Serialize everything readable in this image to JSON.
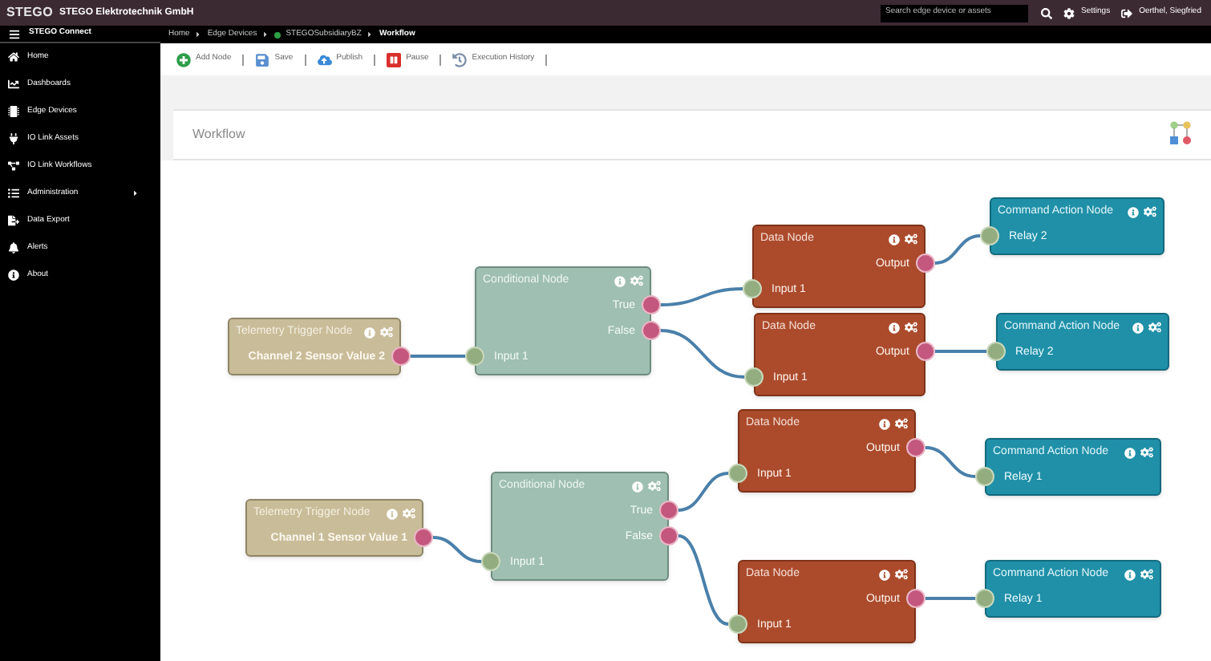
{
  "top_bar": {
    "logo": "STEGO",
    "company": "STEGO Elektrotechnik GmbH",
    "search": {
      "placeholder": "Search edge device or assets"
    },
    "settings": "Settings",
    "user": "Oerthel, Siegfried"
  },
  "sidebar": {
    "title": "STEGO Connect",
    "items": [
      {
        "label": "Home",
        "has_submenu": false
      },
      {
        "label": "Dashboards",
        "has_submenu": false
      },
      {
        "label": "Edge Devices",
        "has_submenu": false
      },
      {
        "label": "IO Link Assets",
        "has_submenu": false
      },
      {
        "label": "IO Link Workflows",
        "has_submenu": false
      },
      {
        "label": "Administration",
        "has_submenu": true
      },
      {
        "label": "Data Export",
        "has_submenu": false
      },
      {
        "label": "Alerts",
        "has_submenu": false
      },
      {
        "label": "About",
        "has_submenu": false
      }
    ]
  },
  "breadcrumb": [
    {
      "label": "Home",
      "status_dot": false
    },
    {
      "label": "Edge Devices",
      "status_dot": false
    },
    {
      "label": "STEGOSubsidiaryBZ",
      "status_dot": true
    },
    {
      "label": "Workflow",
      "status_dot": false
    }
  ],
  "toolbar": [
    {
      "label": "Add Node"
    },
    {
      "label": "Save"
    },
    {
      "label": "Publish"
    },
    {
      "label": "Pause"
    },
    {
      "label": "Execution History"
    }
  ],
  "panel": {
    "title": "Workflow"
  },
  "nodes": [
    {
      "kind": "trigger",
      "title": "Telemetry Trigger Node",
      "outputs": [
        "Channel 2 Sensor Value 2"
      ]
    },
    {
      "kind": "conditional",
      "title": "Conditional Node",
      "outputs": [
        "True",
        "False"
      ],
      "inputs": [
        "Input 1"
      ]
    },
    {
      "kind": "data",
      "title": "Data Node",
      "outputs": [
        "Output"
      ],
      "inputs": [
        "Input 1"
      ]
    },
    {
      "kind": "data",
      "title": "Data Node",
      "outputs": [
        "Output"
      ],
      "inputs": [
        "Input 1"
      ]
    },
    {
      "kind": "command",
      "title": "Command Action Node",
      "inputs": [
        "Relay 2"
      ]
    },
    {
      "kind": "command",
      "title": "Command Action Node",
      "inputs": [
        "Relay 2"
      ]
    },
    {
      "kind": "trigger",
      "title": "Telemetry Trigger Node",
      "outputs": [
        "Channel 1 Sensor Value 1"
      ]
    },
    {
      "kind": "conditional",
      "title": "Conditional Node",
      "outputs": [
        "True",
        "False"
      ],
      "inputs": [
        "Input 1"
      ]
    },
    {
      "kind": "data",
      "title": "Data Node",
      "outputs": [
        "Output"
      ],
      "inputs": [
        "Input 1"
      ]
    },
    {
      "kind": "data",
      "title": "Data Node",
      "outputs": [
        "Output"
      ],
      "inputs": [
        "Input 1"
      ]
    },
    {
      "kind": "command",
      "title": "Command Action Node",
      "inputs": [
        "Relay 1"
      ]
    },
    {
      "kind": "command",
      "title": "Command Action Node",
      "inputs": [
        "Relay 1"
      ]
    }
  ]
}
